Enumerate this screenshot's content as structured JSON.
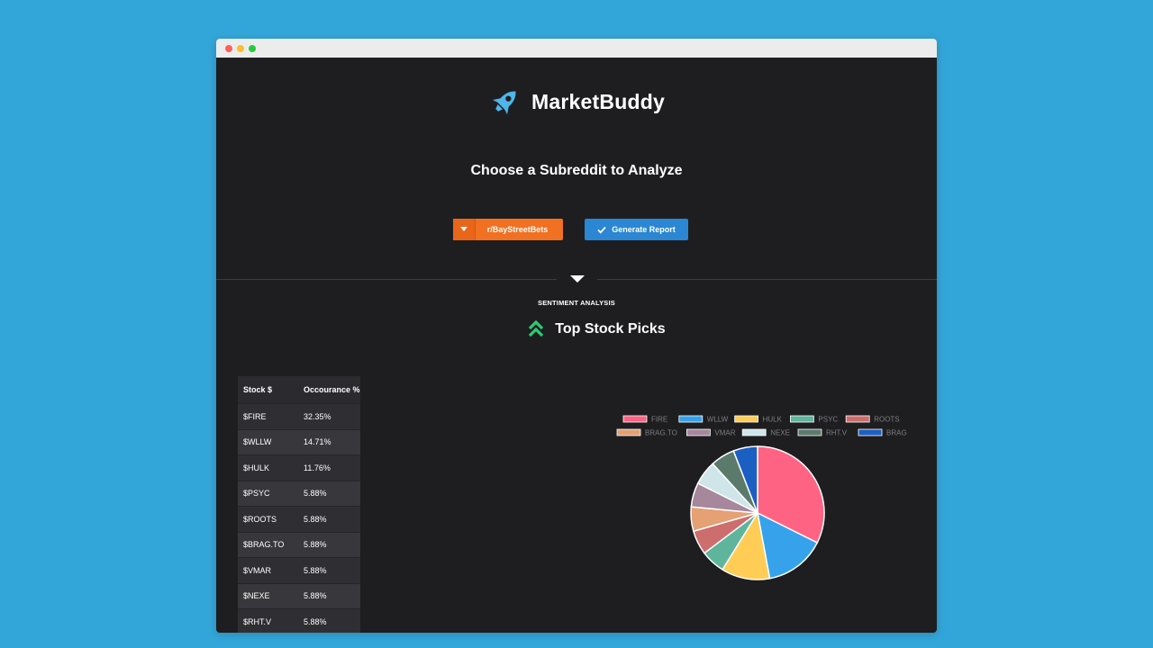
{
  "app": {
    "name": "MarketBuddy",
    "subtitle": "Choose a Subreddit to Analyze"
  },
  "controls": {
    "subreddit_label": "r/BayStreetBets",
    "generate_label": "Generate Report"
  },
  "section": {
    "label": "SENTIMENT ANALYSIS",
    "title": "Top Stock Picks"
  },
  "table": {
    "headers": [
      "Stock $",
      "Occourance %"
    ],
    "rows": [
      [
        "$FIRE",
        "32.35%"
      ],
      [
        "$WLLW",
        "14.71%"
      ],
      [
        "$HULK",
        "11.76%"
      ],
      [
        "$PSYC",
        "5.88%"
      ],
      [
        "$ROOTS",
        "5.88%"
      ],
      [
        "$BRAG.TO",
        "5.88%"
      ],
      [
        "$VMAR",
        "5.88%"
      ],
      [
        "$NEXE",
        "5.88%"
      ],
      [
        "$RHT.V",
        "5.88%"
      ]
    ]
  },
  "colors": {
    "accent_orange": "#f17022",
    "accent_blue": "#2b86d3",
    "logo_blue": "#4fb6ea",
    "chevron_green": "#2ecc71",
    "background": "#1e1e21"
  },
  "chart_data": {
    "type": "pie",
    "legend_position": "top",
    "categories": [
      "FIRE",
      "WLLW",
      "HULK",
      "PSYC",
      "ROOTS",
      "BRAG.TO",
      "VMAR",
      "NEXE",
      "RHT.V",
      "BRAG"
    ],
    "values": [
      32.35,
      14.71,
      11.76,
      5.88,
      5.88,
      5.88,
      5.88,
      5.88,
      5.88,
      5.88
    ],
    "colors": [
      "#ff6384",
      "#36a2eb",
      "#ffcd56",
      "#5fb49c",
      "#cd6d6d",
      "#e5a073",
      "#a6879c",
      "#cfe5ea",
      "#5b7a6c",
      "#1c5fc3"
    ]
  }
}
